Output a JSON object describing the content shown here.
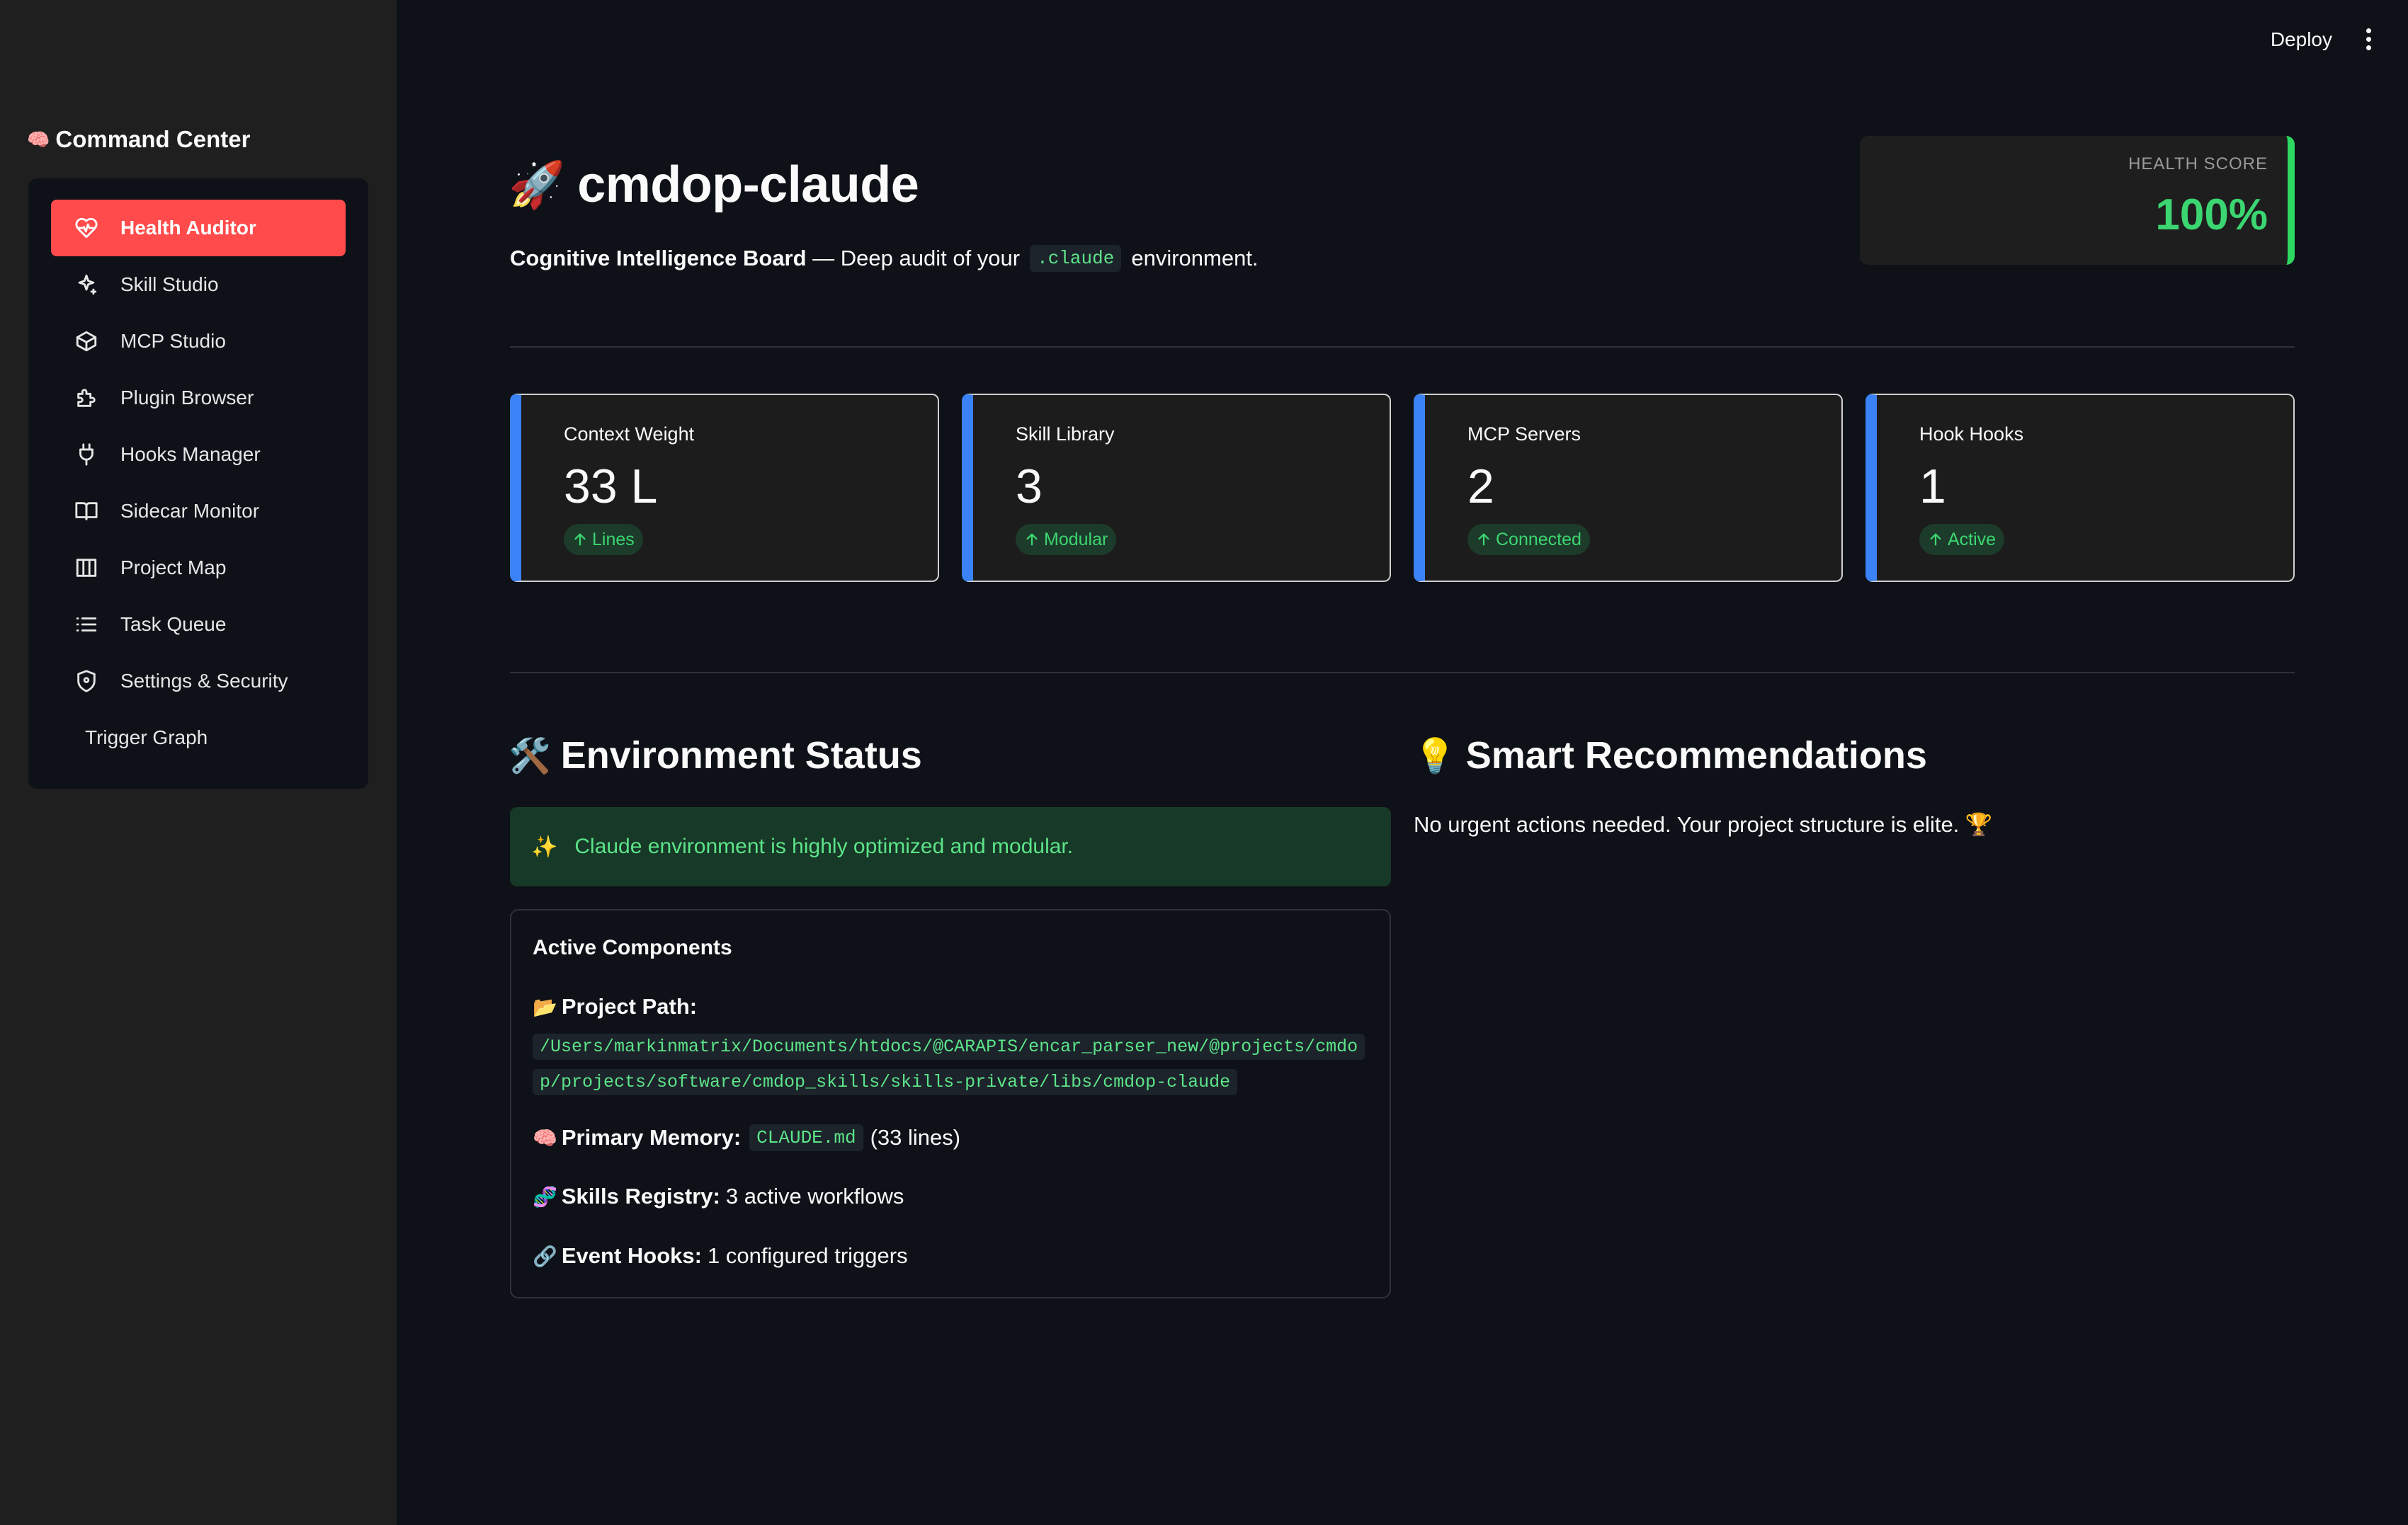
{
  "sidebar": {
    "brand": "Command Center",
    "brand_icon": "brain-icon",
    "items": [
      {
        "label": "Health Auditor",
        "icon": "heart-pulse-icon",
        "active": true
      },
      {
        "label": "Skill Studio",
        "icon": "sparkles-icon"
      },
      {
        "label": "MCP Studio",
        "icon": "box-icon"
      },
      {
        "label": "Plugin Browser",
        "icon": "puzzle-icon"
      },
      {
        "label": "Hooks Manager",
        "icon": "plug-icon"
      },
      {
        "label": "Sidecar Monitor",
        "icon": "book-open-icon"
      },
      {
        "label": "Project Map",
        "icon": "map-icon"
      },
      {
        "label": "Task Queue",
        "icon": "list-icon"
      },
      {
        "label": "Settings & Security",
        "icon": "shield-icon"
      },
      {
        "label": "Trigger Graph",
        "icon": ""
      }
    ]
  },
  "topbar": {
    "deploy": "Deploy",
    "menu_icon": "kebab-menu-icon"
  },
  "header": {
    "emoji": "🚀",
    "title": "cmdop-claude",
    "subtitle_bold": "Cognitive Intelligence Board",
    "subtitle_rest": " — Deep audit of your",
    "subtitle_code": ".claude",
    "subtitle_end": "environment."
  },
  "health": {
    "label": "HEALTH SCORE",
    "value": "100%"
  },
  "metrics": [
    {
      "label": "Context Weight",
      "value": "33 L",
      "delta": "Lines"
    },
    {
      "label": "Skill Library",
      "value": "3",
      "delta": "Modular"
    },
    {
      "label": "MCP Servers",
      "value": "2",
      "delta": "Connected"
    },
    {
      "label": "Hook Hooks",
      "value": "1",
      "delta": "Active"
    }
  ],
  "env_status": {
    "emoji": "🛠️",
    "title": "Environment Status",
    "success_emoji": "✨",
    "success_text": "Claude environment is highly optimized and modular.",
    "components_title": "Active Components",
    "project_path_emoji": "📂",
    "project_path_label": "Project Path:",
    "project_path": "/Users/markinmatrix/Documents/htdocs/@CARAPIS/encar_parser_new/@projects/cmdop/projects/software/cmdop_skills/skills-private/libs/cmdop-claude",
    "memory_emoji": "🧠",
    "memory_label": "Primary Memory:",
    "memory_file": "CLAUDE.md",
    "memory_lines": "(33 lines)",
    "skills_emoji": "🧬",
    "skills_label": "Skills Registry:",
    "skills_value": "3 active workflows",
    "hooks_emoji": "🔗",
    "hooks_label": "Event Hooks:",
    "hooks_value": "1 configured triggers"
  },
  "recommendations": {
    "emoji": "💡",
    "title": "Smart Recommendations",
    "text": "No urgent actions needed. Your project structure is elite. 🏆"
  },
  "colors": {
    "accent": "#ff4b4b",
    "card_border": "#3b82f6",
    "positive": "#3bd671",
    "health_bar": "#2ed760"
  }
}
